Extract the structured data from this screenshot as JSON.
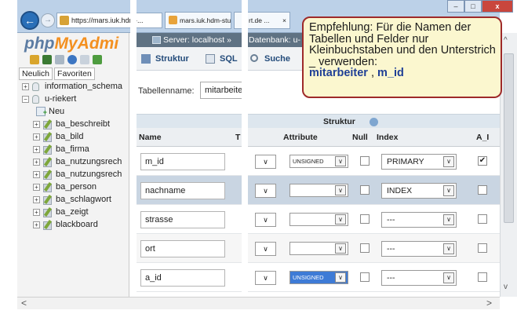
{
  "browser": {
    "back": "←",
    "forward": "→",
    "address": "https://mars.iuk.hdm-...",
    "address_controls": "ρ ▾ 🔒 C",
    "tab1": "mars.iuk.hdm-stu",
    "tab2": "rt.de ...",
    "tab2_close": "×",
    "min": "–",
    "max": "□",
    "close": "x"
  },
  "left_panel": {
    "logo_php": "php",
    "logo_my": "MyAdmi",
    "link_recent": "Neulich",
    "link_favorites": "Favoriten",
    "tree": [
      {
        "label": "information_schema",
        "kind": "db",
        "pm": "+"
      },
      {
        "label": "u-riekert",
        "kind": "db",
        "pm": "−"
      },
      {
        "label": "Neu",
        "kind": "new"
      },
      {
        "label": "ba_beschreibt",
        "kind": "table",
        "pm": "+"
      },
      {
        "label": "ba_bild",
        "kind": "table",
        "pm": "+"
      },
      {
        "label": "ba_firma",
        "kind": "table",
        "pm": "+"
      },
      {
        "label": "ba_nutzungsrech",
        "kind": "table",
        "pm": "+"
      },
      {
        "label": "ba_nutzungsrech",
        "kind": "table",
        "pm": "+"
      },
      {
        "label": "ba_person",
        "kind": "table",
        "pm": "+"
      },
      {
        "label": "ba_schlagwort",
        "kind": "table",
        "pm": "+"
      },
      {
        "label": "ba_zeigt",
        "kind": "table",
        "pm": "+"
      },
      {
        "label": "blackboard",
        "kind": "table",
        "pm": "+"
      }
    ]
  },
  "breadcrumb": {
    "server": "Server: localhost »",
    "database": "Datenbank: u-"
  },
  "tabs": {
    "structure": "Struktur",
    "sql": "SQL",
    "search": "Suche"
  },
  "table_name": {
    "label": "Tabellenname:",
    "value": "mitarbeite"
  },
  "structure_title": "Struktur",
  "headers": {
    "name": "Name",
    "type": "T",
    "attribute": "Attribute",
    "null": "Null",
    "index": "Index",
    "ai": "A_I"
  },
  "rows": [
    {
      "name": "m_id",
      "attribute": "UNSIGNED",
      "attr_highlight": false,
      "null": "",
      "index": "PRIMARY",
      "ai": "✔"
    },
    {
      "name": "nachname",
      "attribute": "",
      "attr_highlight": false,
      "null": "",
      "index": "INDEX",
      "ai": ""
    },
    {
      "name": "strasse",
      "attribute": "",
      "attr_highlight": false,
      "null": "",
      "index": "---",
      "ai": ""
    },
    {
      "name": "ort",
      "attribute": "",
      "attr_highlight": false,
      "null": "",
      "index": "---",
      "ai": ""
    },
    {
      "name": "a_id",
      "attribute": "UNSIGNED",
      "attr_highlight": true,
      "null": "",
      "index": "---",
      "ai": ""
    }
  ],
  "dropdown_arrow": "∨",
  "scroll": {
    "left": "<",
    "right": ">",
    "up": "^",
    "down": "v"
  },
  "note": {
    "text": "Empfehlung: Für die Namen der Tabellen und Felder nur Kleinbuchstaben und den Unterstrich _ verwenden:",
    "example_1": "mitarbeiter",
    "sep": " , ",
    "example_2": "m_id"
  },
  "colors": {
    "brand_php": "#5c7ca3",
    "brand_my": "#f39020",
    "note_border": "#9e2a2a",
    "note_bg": "#fbf7cf",
    "note_highlight": "#1f3f96"
  }
}
